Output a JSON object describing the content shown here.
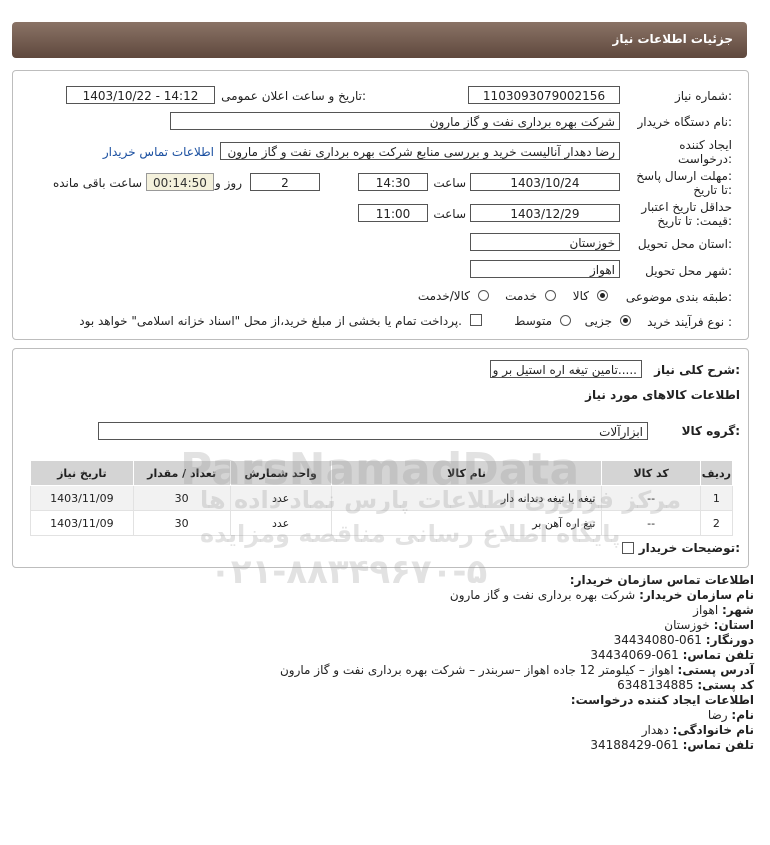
{
  "header": {
    "title": "جزئیات اطلاعات نیاز"
  },
  "form": {
    "need_number": {
      "label": "شماره نیاز:",
      "value": "1103093079002156"
    },
    "announce_datetime": {
      "label": "تاریخ و ساعت اعلان عمومی:",
      "value": "1403/10/22 - 14:12"
    },
    "buyer_org": {
      "label": "نام دستگاه خریدار:",
      "value": "شرکت بهره برداری نفت و گاز مارون"
    },
    "requester": {
      "label_line1": "ایجاد کننده",
      "label_line2": "درخواست:",
      "value": "رضا دهدار آنالیست خرید و بررسی منابع شرکت بهره برداری نفت و گاز مارون",
      "contact_link": "اطلاعات تماس خریدار"
    },
    "deadline": {
      "label_line1": "مهلت ارسال پاسخ:",
      "label_line2": "تا تاریخ:",
      "date": "1403/10/24",
      "time_label": "ساعت",
      "time": "14:30",
      "days": "2",
      "days_label": "روز و",
      "remaining": "00:14:50",
      "remaining_label": "ساعت باقی مانده"
    },
    "validity": {
      "label_line1": "حداقل تاریخ اعتبار",
      "label_line2": "قیمت: تا تاریخ:",
      "date": "1403/12/29",
      "time_label": "ساعت",
      "time": "11:00"
    },
    "province": {
      "label": "استان محل تحویل:",
      "value": "خوزستان"
    },
    "city": {
      "label": "شهر محل تحویل:",
      "value": "اهواز"
    },
    "category": {
      "label": "طبقه بندی موضوعی:",
      "options": [
        "کالا",
        "خدمت",
        "کالا/خدمت"
      ]
    },
    "process": {
      "label": "نوع فرآیند خرید :",
      "options": [
        "جزیی",
        "متوسط"
      ],
      "payment_note": "پرداخت تمام یا بخشی از مبلغ خرید،از محل \"اسناد خزانه اسلامی\" خواهد بود."
    }
  },
  "summary": {
    "label": "شرح کلی نیاز:",
    "value": "تامین تیغه اره استیل بر و.....",
    "items_title": "اطلاعات کالاهای مورد نیاز",
    "group_label": "گروه کالا:",
    "group_value": "ابزارآلات",
    "columns": [
      "ردیف",
      "کد کالا",
      "نام کالا",
      "واحد شمارش",
      "تعداد / مقدار",
      "تاریخ نیاز"
    ],
    "rows": [
      [
        "1",
        "--",
        "تیغه یا تیغه دندانه دار",
        "عدد",
        "30",
        "1403/11/09"
      ],
      [
        "2",
        "--",
        "تیغ اره آهن بر",
        "عدد",
        "30",
        "1403/11/09"
      ]
    ],
    "buyer_notes_label": "توضیحات خریدار:"
  },
  "contact": {
    "title": "اطلاعات تماس سازمان خریدار:",
    "org_label": "نام سازمان خریدار:",
    "org": "شرکت بهره برداری نفت و گاز مارون",
    "city_label": "شهر:",
    "city": "اهواز",
    "province_label": "استان:",
    "province": "خوزستان",
    "fax_label": "دورنگار:",
    "fax": "061-34434080",
    "phone_label": "تلفن تماس:",
    "phone": "061-34434069",
    "address_label": "آدرس پستی:",
    "address": "اهواز – کیلومتر 12 جاده اهواز –سربندر – شرکت بهره برداری نفت و گاز مارون",
    "postal_label": "کد پستی:",
    "postal": "6348134885",
    "creator_title": "اطلاعات ایجاد کننده درخواست:",
    "name_label": "نام:",
    "name": "رضا",
    "family_label": "نام خانوادگی:",
    "family": "دهدار",
    "creator_phone_label": "تلفن تماس:",
    "creator_phone": "061-34188429"
  },
  "watermark": {
    "brand": "ParsNamadData",
    "tagline": "مرکز فراوری اطلاعات پارس نماد داده ها",
    "portal": "پایگاه اطلاع رسانی مناقصه ومزایده",
    "phone": "۰۲۱-۸۸۳۴۹۶۷۰-۵"
  },
  "colors": {
    "header_bg": "#6f574a",
    "link": "#1a4fa0",
    "timer_bg": "#f4f1dc",
    "table_header": "#d4d4d4"
  }
}
